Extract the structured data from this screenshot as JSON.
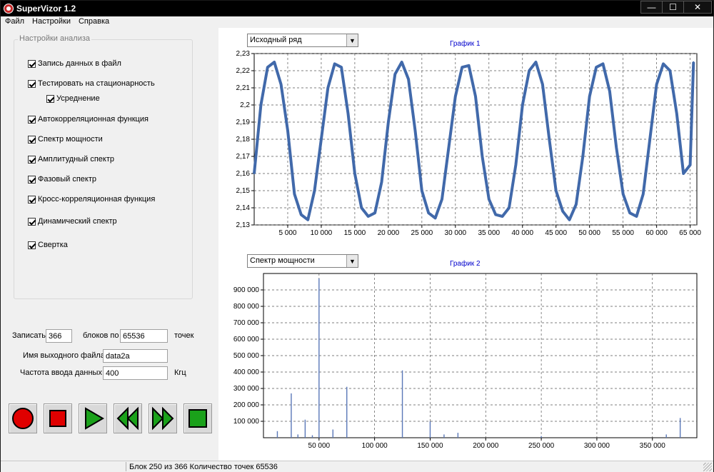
{
  "window": {
    "title": "SuperVizor 1.2",
    "controls": [
      "—",
      "☐",
      "✕"
    ]
  },
  "menu": [
    "Файл",
    "Настройки",
    "Справка"
  ],
  "settings": {
    "group_title": "Настройки анализа",
    "options": [
      {
        "label": "Запись данных в файл",
        "checked": true
      },
      {
        "label": "Тестировать на стационарность",
        "checked": true
      },
      {
        "label": "Усреднение",
        "checked": true
      },
      {
        "label": "Автокорреляционная функция",
        "checked": true
      },
      {
        "label": "Спектр мощности",
        "checked": true
      },
      {
        "label": "Амплитудный спектр",
        "checked": true
      },
      {
        "label": "Фазовый спектр",
        "checked": true
      },
      {
        "label": "Кросс-корреляционная функция",
        "checked": true
      },
      {
        "label": "Динамический спектр",
        "checked": true
      },
      {
        "label": "Свертка",
        "checked": true
      }
    ]
  },
  "recording": {
    "write_label": "Записать",
    "blocks_value": "366",
    "blocks_by_label": "блоков по",
    "points_value": "65536",
    "points_label": "точек",
    "outfile_label": "Имя выходного файла",
    "outfile_value": "data2a",
    "freq_label": "Частота ввода данных",
    "freq_value": "400",
    "freq_unit": "Кгц"
  },
  "controls": [
    {
      "name": "record",
      "icon": "record-icon",
      "color": "#e00000"
    },
    {
      "name": "stop",
      "icon": "stop-icon",
      "color": "#e00000"
    },
    {
      "name": "play",
      "icon": "play-icon",
      "color": "#1aa11a"
    },
    {
      "name": "rewind",
      "icon": "rewind-icon",
      "color": "#1aa11a"
    },
    {
      "name": "fast-forward",
      "icon": "fast-forward-icon",
      "color": "#1aa11a"
    },
    {
      "name": "stop-green",
      "icon": "square-icon",
      "color": "#1aa11a"
    }
  ],
  "chart1": {
    "selector": "Исходный ряд",
    "title": "График 1"
  },
  "chart2": {
    "selector": "Спектр мощности",
    "title": "График 2"
  },
  "status": {
    "text": "Блок 250 из 366 Количество точек 65536"
  },
  "chart_data": [
    {
      "type": "line",
      "title": "График 1",
      "line_color": "#4169aa",
      "xlim": [
        0,
        66000
      ],
      "ylim": [
        2.13,
        2.23
      ],
      "xticks": [
        5000,
        10000,
        15000,
        20000,
        25000,
        30000,
        35000,
        40000,
        45000,
        50000,
        55000,
        60000,
        65000
      ],
      "xtick_labels": [
        "5 000",
        "10 000",
        "15 000",
        "20 000",
        "25 000",
        "30 000",
        "35 000",
        "40 000",
        "45 000",
        "50 000",
        "55 000",
        "60 000",
        "65 000"
      ],
      "yticks": [
        2.13,
        2.14,
        2.15,
        2.16,
        2.17,
        2.18,
        2.19,
        2.2,
        2.21,
        2.22,
        2.23
      ],
      "ytick_labels": [
        "2,13",
        "2,14",
        "2,15",
        "2,16",
        "2,17",
        "2,18",
        "2,19",
        "2,2",
        "2,21",
        "2,22",
        "2,23"
      ],
      "grid": true,
      "series": [
        {
          "x": [
            0,
            1000,
            2000,
            3000,
            4000,
            5000,
            6000,
            7000,
            8000,
            9000,
            10000,
            11000,
            12000,
            13000,
            14000,
            15000,
            16000,
            17000,
            18000,
            19000,
            20000,
            21000,
            22000,
            23000,
            24000,
            25000,
            26000,
            27000,
            28000,
            29000,
            30000,
            31000,
            32000,
            33000,
            34000,
            35000,
            36000,
            37000,
            38000,
            39000,
            40000,
            41000,
            42000,
            43000,
            44000,
            45000,
            46000,
            47000,
            48000,
            49000,
            50000,
            51000,
            52000,
            53000,
            54000,
            55000,
            56000,
            57000,
            58000,
            59000,
            60000,
            61000,
            62000,
            63000,
            64000,
            65000,
            65500
          ],
          "y": [
            2.16,
            2.2,
            2.222,
            2.225,
            2.212,
            2.185,
            2.148,
            2.136,
            2.133,
            2.15,
            2.18,
            2.21,
            2.224,
            2.222,
            2.195,
            2.16,
            2.14,
            2.135,
            2.137,
            2.155,
            2.19,
            2.218,
            2.225,
            2.215,
            2.185,
            2.15,
            2.137,
            2.134,
            2.145,
            2.175,
            2.205,
            2.222,
            2.223,
            2.205,
            2.17,
            2.145,
            2.136,
            2.135,
            2.14,
            2.165,
            2.2,
            2.22,
            2.225,
            2.212,
            2.18,
            2.15,
            2.138,
            2.133,
            2.142,
            2.17,
            2.205,
            2.222,
            2.224,
            2.208,
            2.175,
            2.148,
            2.137,
            2.135,
            2.148,
            2.18,
            2.212,
            2.224,
            2.22,
            2.195,
            2.16,
            2.165,
            2.225
          ]
        }
      ]
    },
    {
      "type": "bar",
      "title": "График 2",
      "bar_color": "#5a78b8",
      "xlim": [
        0,
        390000
      ],
      "ylim": [
        0,
        1000000
      ],
      "xticks": [
        50000,
        100000,
        150000,
        200000,
        250000,
        300000,
        350000
      ],
      "xtick_labels": [
        "50 000",
        "100 000",
        "150 000",
        "200 000",
        "250 000",
        "300 000",
        "350 000"
      ],
      "yticks": [
        100000,
        200000,
        300000,
        400000,
        500000,
        600000,
        700000,
        800000,
        900000
      ],
      "ytick_labels": [
        "100 000",
        "200 000",
        "300 000",
        "400 000",
        "500 000",
        "600 000",
        "700 000",
        "800 000",
        "900 000"
      ],
      "grid": true,
      "series": [
        {
          "x": [
            12500,
            25000,
            31000,
            37500,
            44000,
            50000,
            62500,
            75000,
            125000,
            150000,
            162500,
            175000,
            250000,
            362500,
            375000
          ],
          "values": [
            40000,
            270000,
            20000,
            110000,
            15000,
            970000,
            50000,
            310000,
            410000,
            100000,
            20000,
            30000,
            10000,
            20000,
            120000
          ]
        }
      ]
    }
  ]
}
